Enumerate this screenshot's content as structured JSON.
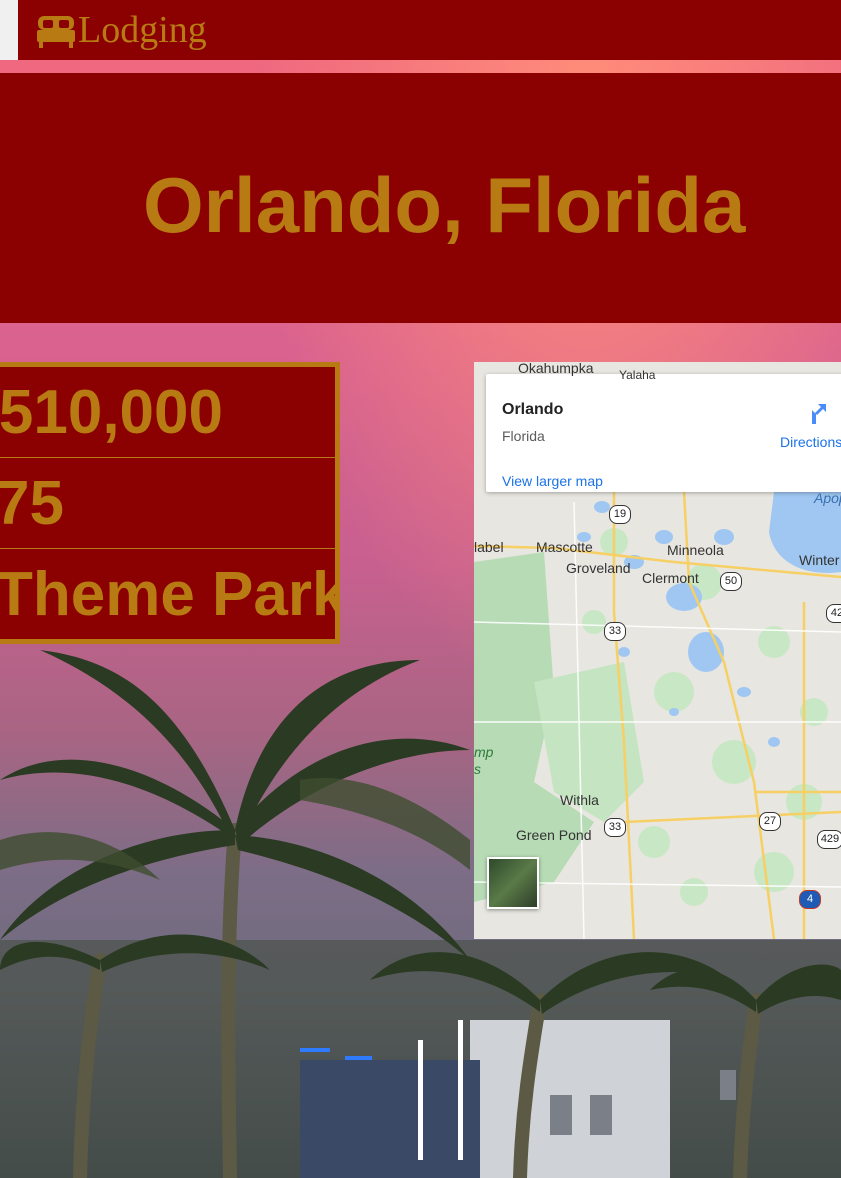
{
  "nav": {
    "brand": "Lodging"
  },
  "hero": {
    "title": "Orlando, Florida"
  },
  "stats": {
    "population": "510,000",
    "number": "75",
    "theme_parks": "Theme Parks"
  },
  "map": {
    "place_name": "Orlando",
    "place_region": "Florida",
    "directions_label": "Directions",
    "view_larger": "View larger map",
    "labels": {
      "okahumpka": "Okahumpka",
      "yalaha": "Yalaha",
      "mascotte": "Mascotte",
      "minneola": "Minneola",
      "groveland": "Groveland",
      "clermont": "Clermont",
      "winter": "Winter",
      "withla": "Withla",
      "green_pond": "Green Pond",
      "label_edge": "label",
      "hapop": "Apop",
      "mp": "mp",
      "ss": "s"
    },
    "shields": {
      "r19": "19",
      "r50": "50",
      "r33a": "33",
      "r33b": "33",
      "r27": "27",
      "r429": "429",
      "r4": "4",
      "r42": "42"
    }
  },
  "colors": {
    "brand_red": "#8b0000",
    "brand_gold": "#b87a12",
    "link_blue": "#1a73e8"
  },
  "icons": {
    "brand": "bed-icon",
    "directions": "directions-icon"
  }
}
